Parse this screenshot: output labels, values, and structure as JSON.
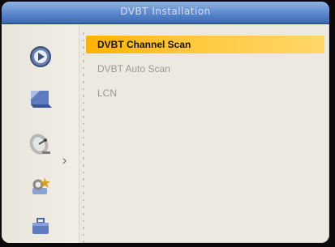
{
  "window": {
    "title": "DVBT Installation"
  },
  "sidebar": {
    "items": [
      {
        "icon": "play-circle-icon"
      },
      {
        "icon": "tv-screen-icon"
      },
      {
        "icon": "satellite-dish-icon",
        "selected": true
      },
      {
        "icon": "tools-icon"
      },
      {
        "icon": "briefcase-icon"
      }
    ]
  },
  "menu": {
    "items": [
      {
        "label": "DVBT Channel Scan",
        "selected": true
      },
      {
        "label": "DVBT Auto Scan"
      },
      {
        "label": "LCN"
      }
    ]
  },
  "colors": {
    "title_bar": "#5d88cc",
    "highlight": "#ffc838",
    "background": "#ece9e0"
  }
}
